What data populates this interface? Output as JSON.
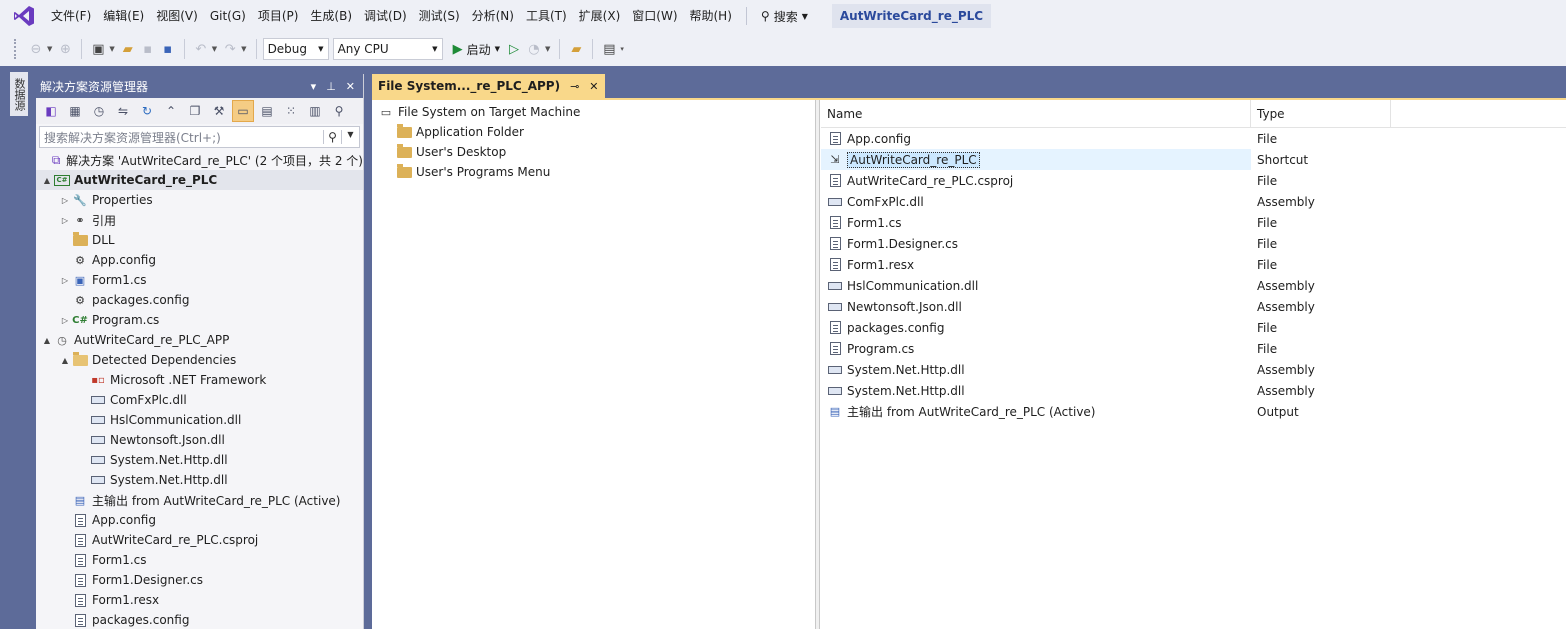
{
  "menubar": {
    "items": [
      "文件(F)",
      "编辑(E)",
      "视图(V)",
      "Git(G)",
      "项目(P)",
      "生成(B)",
      "调试(D)",
      "测试(S)",
      "分析(N)",
      "工具(T)",
      "扩展(X)",
      "窗口(W)",
      "帮助(H)"
    ],
    "search_label": "搜索",
    "title": "AutWriteCard_re_PLC"
  },
  "toolbar": {
    "config": "Debug",
    "platform": "Any CPU",
    "start_label": "启动"
  },
  "side_rail": {
    "tab_label": "数据源"
  },
  "solution_explorer": {
    "title": "解决方案资源管理器",
    "search_placeholder": "搜索解决方案资源管理器(Ctrl+;)",
    "rows": [
      {
        "indent": 0,
        "twisty": "",
        "icon": "solution",
        "label": "解决方案 'AutWriteCard_re_PLC' (2 个项目，共 2 个)",
        "bold": false
      },
      {
        "indent": 0,
        "twisty": "▲",
        "icon": "csproj",
        "label": "AutWriteCard_re_PLC",
        "bold": true
      },
      {
        "indent": 1,
        "twisty": "▷",
        "icon": "wrench",
        "label": "Properties",
        "bold": false
      },
      {
        "indent": 1,
        "twisty": "▷",
        "icon": "references",
        "label": "引用",
        "bold": false
      },
      {
        "indent": 1,
        "twisty": "",
        "icon": "folder",
        "label": "DLL",
        "bold": false
      },
      {
        "indent": 1,
        "twisty": "",
        "icon": "config",
        "label": "App.config",
        "bold": false
      },
      {
        "indent": 1,
        "twisty": "▷",
        "icon": "form",
        "label": "Form1.cs",
        "bold": false
      },
      {
        "indent": 1,
        "twisty": "",
        "icon": "config",
        "label": "packages.config",
        "bold": false
      },
      {
        "indent": 1,
        "twisty": "▷",
        "icon": "csharp",
        "label": "Program.cs",
        "bold": false
      },
      {
        "indent": 0,
        "twisty": "▲",
        "icon": "setup",
        "label": "AutWriteCard_re_PLC_APP",
        "bold": false
      },
      {
        "indent": 1,
        "twisty": "▲",
        "icon": "folder-open",
        "label": "Detected Dependencies",
        "bold": false
      },
      {
        "indent": 2,
        "twisty": "",
        "icon": "framework",
        "label": "Microsoft .NET Framework",
        "bold": false
      },
      {
        "indent": 2,
        "twisty": "",
        "icon": "dll",
        "label": "ComFxPlc.dll",
        "bold": false
      },
      {
        "indent": 2,
        "twisty": "",
        "icon": "dll",
        "label": "HslCommunication.dll",
        "bold": false
      },
      {
        "indent": 2,
        "twisty": "",
        "icon": "dll",
        "label": "Newtonsoft.Json.dll",
        "bold": false
      },
      {
        "indent": 2,
        "twisty": "",
        "icon": "dll",
        "label": "System.Net.Http.dll",
        "bold": false
      },
      {
        "indent": 2,
        "twisty": "",
        "icon": "dll",
        "label": "System.Net.Http.dll",
        "bold": false
      },
      {
        "indent": 1,
        "twisty": "",
        "icon": "output",
        "label": "主输出 from AutWriteCard_re_PLC (Active)",
        "bold": false
      },
      {
        "indent": 1,
        "twisty": "",
        "icon": "file",
        "label": "App.config",
        "bold": false
      },
      {
        "indent": 1,
        "twisty": "",
        "icon": "file",
        "label": "AutWriteCard_re_PLC.csproj",
        "bold": false
      },
      {
        "indent": 1,
        "twisty": "",
        "icon": "file",
        "label": "Form1.cs",
        "bold": false
      },
      {
        "indent": 1,
        "twisty": "",
        "icon": "file",
        "label": "Form1.Designer.cs",
        "bold": false
      },
      {
        "indent": 1,
        "twisty": "",
        "icon": "file",
        "label": "Form1.resx",
        "bold": false
      },
      {
        "indent": 1,
        "twisty": "",
        "icon": "file",
        "label": "packages.config",
        "bold": false
      }
    ]
  },
  "document": {
    "tab_title": "File System..._re_PLC_APP)",
    "fs_tree": [
      {
        "indent": 0,
        "icon": "machine",
        "label": "File System on Target Machine"
      },
      {
        "indent": 1,
        "icon": "folder",
        "label": "Application Folder"
      },
      {
        "indent": 1,
        "icon": "folder",
        "label": "User's Desktop"
      },
      {
        "indent": 1,
        "icon": "folder",
        "label": "User's Programs Menu"
      }
    ],
    "list": {
      "col_name": "Name",
      "col_type": "Type",
      "rows": [
        {
          "name": "App.config",
          "type": "File",
          "icon": "file",
          "selected": false
        },
        {
          "name": "AutWriteCard_re_PLC",
          "type": "Shortcut",
          "icon": "shortcut",
          "selected": true
        },
        {
          "name": "AutWriteCard_re_PLC.csproj",
          "type": "File",
          "icon": "file",
          "selected": false
        },
        {
          "name": "ComFxPlc.dll",
          "type": "Assembly",
          "icon": "dll",
          "selected": false
        },
        {
          "name": "Form1.cs",
          "type": "File",
          "icon": "file",
          "selected": false
        },
        {
          "name": "Form1.Designer.cs",
          "type": "File",
          "icon": "file",
          "selected": false
        },
        {
          "name": "Form1.resx",
          "type": "File",
          "icon": "file",
          "selected": false
        },
        {
          "name": "HslCommunication.dll",
          "type": "Assembly",
          "icon": "dll",
          "selected": false
        },
        {
          "name": "Newtonsoft.Json.dll",
          "type": "Assembly",
          "icon": "dll",
          "selected": false
        },
        {
          "name": "packages.config",
          "type": "File",
          "icon": "file",
          "selected": false
        },
        {
          "name": "Program.cs",
          "type": "File",
          "icon": "file",
          "selected": false
        },
        {
          "name": "System.Net.Http.dll",
          "type": "Assembly",
          "icon": "dll",
          "selected": false
        },
        {
          "name": "System.Net.Http.dll",
          "type": "Assembly",
          "icon": "dll",
          "selected": false
        },
        {
          "name": "主输出 from AutWriteCard_re_PLC (Active)",
          "type": "Output",
          "icon": "output",
          "selected": false
        }
      ]
    }
  },
  "colors": {
    "accent": "#5d6b99",
    "tab_active": "#f9d88a",
    "title_text": "#2b4a9c",
    "selection": "#cce8ff"
  }
}
